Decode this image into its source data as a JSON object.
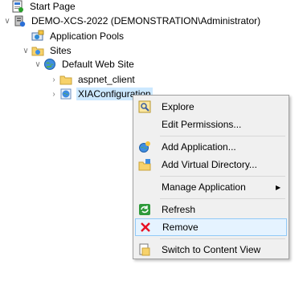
{
  "tree": [
    {
      "label": "Start Page",
      "icon": "start-page-icon"
    },
    {
      "label": "DEMO-XCS-2022 (DEMONSTRATION\\Administrator)",
      "icon": "server-icon"
    },
    {
      "label": "Application Pools",
      "icon": "app-pools-icon"
    },
    {
      "label": "Sites",
      "icon": "sites-folder-icon"
    },
    {
      "label": "Default Web Site",
      "icon": "globe-icon"
    },
    {
      "label": "aspnet_client",
      "icon": "folder-icon"
    },
    {
      "label": "XIAConfiguration",
      "icon": "web-app-icon"
    }
  ],
  "menu": {
    "items": [
      {
        "label": "Explore",
        "icon": "explore-icon"
      },
      {
        "label": "Edit Permissions...",
        "icon": ""
      },
      {
        "label": "Add Application...",
        "icon": "add-application-icon"
      },
      {
        "label": "Add Virtual Directory...",
        "icon": "add-virtual-directory-icon"
      },
      {
        "label": "Manage Application",
        "icon": ""
      },
      {
        "label": "Refresh",
        "icon": "refresh-icon"
      },
      {
        "label": "Remove",
        "icon": "remove-icon"
      },
      {
        "label": "Switch to Content View",
        "icon": "content-view-icon"
      }
    ],
    "hover_item": "Remove"
  },
  "colors": {
    "selection": "#cce8ff",
    "hover_bg": "#e5f3ff",
    "hover_border": "#91c9f7",
    "remove_red": "#e81123"
  }
}
